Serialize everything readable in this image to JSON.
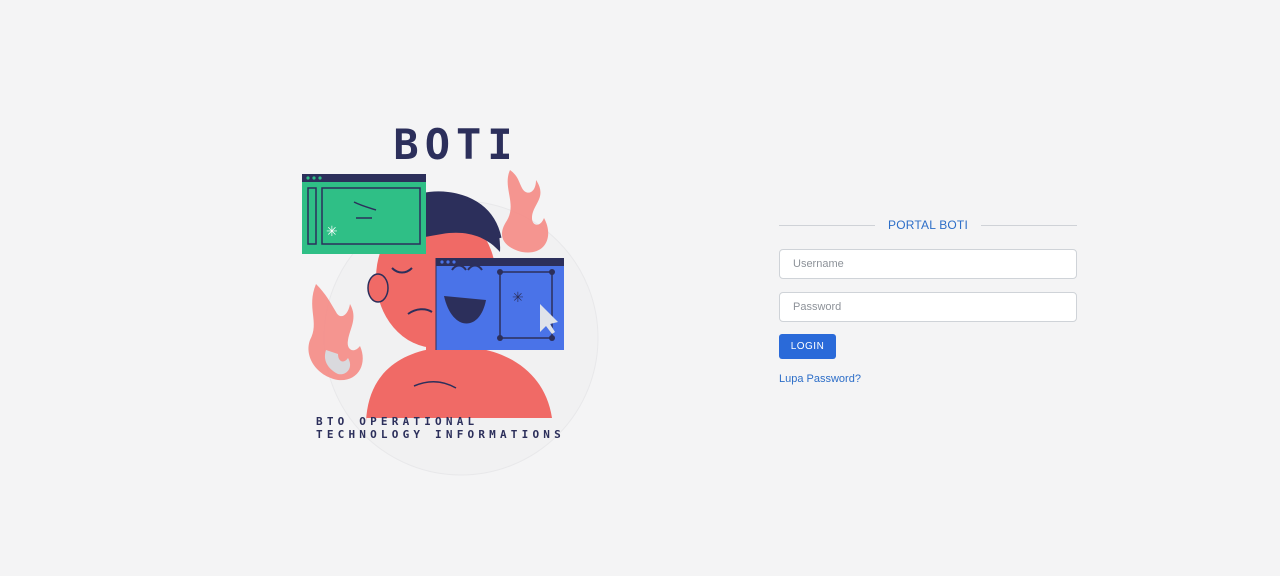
{
  "logo": {
    "title": "BOTI",
    "subtitle_line1": "BTO OPERATIONAL",
    "subtitle_line2": "TECHNOLOGY INFORMATIONS"
  },
  "login_form": {
    "header": "PORTAL BOTI",
    "username_placeholder": "Username",
    "username_value": "",
    "password_placeholder": "Password",
    "password_value": "",
    "login_button_label": "LOGIN",
    "forgot_password_link": "Lupa Password?"
  },
  "colors": {
    "background": "#f4f4f5",
    "accent": "#2a6ad9",
    "logo_text": "#2c2f5b",
    "illus_green": "#2fbf86",
    "illus_blue": "#4a73e8",
    "illus_coral": "#f26b6b"
  }
}
